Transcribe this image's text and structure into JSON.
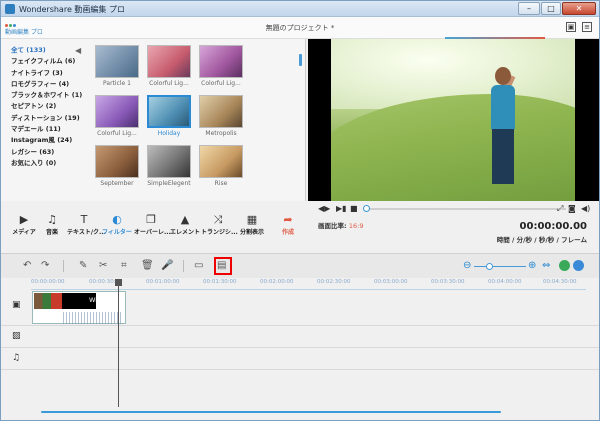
{
  "window": {
    "title": "Wondershare 動画編集 プロ",
    "controls": [
      "–",
      "□",
      "✕"
    ]
  },
  "appbar": {
    "logo_text": "動画編集 プロ",
    "project_title": "無題のプロジェクト *"
  },
  "categories": [
    {
      "label": "全て (133)",
      "selected": true
    },
    {
      "label": "フェイクフィルム (6)"
    },
    {
      "label": "ナイトライフ (3)"
    },
    {
      "label": "ロモグラフィー (4)"
    },
    {
      "label": "ブラック＆ホワイト (1)"
    },
    {
      "label": "セピアトン (2)"
    },
    {
      "label": "ディストーション (19)"
    },
    {
      "label": "マデエール (11)"
    },
    {
      "label": "Instagram風 (24)"
    },
    {
      "label": "レガシー (63)"
    },
    {
      "label": "お気に入り (0)"
    }
  ],
  "filters": [
    {
      "label": "Particle 1",
      "color": "#8aa0b8"
    },
    {
      "label": "Colorful Lig...",
      "color": "#d07a8a"
    },
    {
      "label": "Colorful Lig...",
      "color": "#b86fa8"
    },
    {
      "label": "Colorful Lig...",
      "color": "#a77ac9"
    },
    {
      "label": "Holiday",
      "color": "#5b9ac0",
      "selected": true
    },
    {
      "label": "Metropolis",
      "color": "#b59a6e"
    },
    {
      "label": "September",
      "color": "#8b6a4a"
    },
    {
      "label": "SimpleElegent",
      "color": "#7d7d7d"
    },
    {
      "label": "Rise",
      "color": "#c7a071"
    }
  ],
  "tools": [
    {
      "label": "メディア",
      "icon": "▶"
    },
    {
      "label": "音楽",
      "icon": "♫"
    },
    {
      "label": "テキスト/ク...",
      "icon": "T"
    },
    {
      "label": "フィルター",
      "icon": "◐",
      "active": true
    },
    {
      "label": "オーバーレ...",
      "icon": "❐"
    },
    {
      "label": "エレメント",
      "icon": "▲"
    },
    {
      "label": "トランジシ...",
      "icon": "⤨"
    },
    {
      "label": "分割表示",
      "icon": "▦"
    },
    {
      "label": "作成",
      "icon": "➦",
      "red": true
    }
  ],
  "player": {
    "aspect_label": "画面比率:",
    "aspect_value": "16:9",
    "timecode": "00:00:00.00",
    "timecode_format": "時間 / 分/秒 / 秒/秒 / フレーム"
  },
  "timeline": {
    "ruler": [
      "00:00:00:00",
      "00:00:30:00",
      "00:01:00:00",
      "00:01:30:00",
      "00:02:00:00",
      "00:02:30:00",
      "00:03:00:00",
      "00:03:30:00",
      "00:04:00:00",
      "00:04:30:00"
    ],
    "clip_title": "Wildlife"
  },
  "colors": {
    "accent": "#2a8ad4",
    "create": "#e05a44",
    "highlight": "#e00000"
  }
}
